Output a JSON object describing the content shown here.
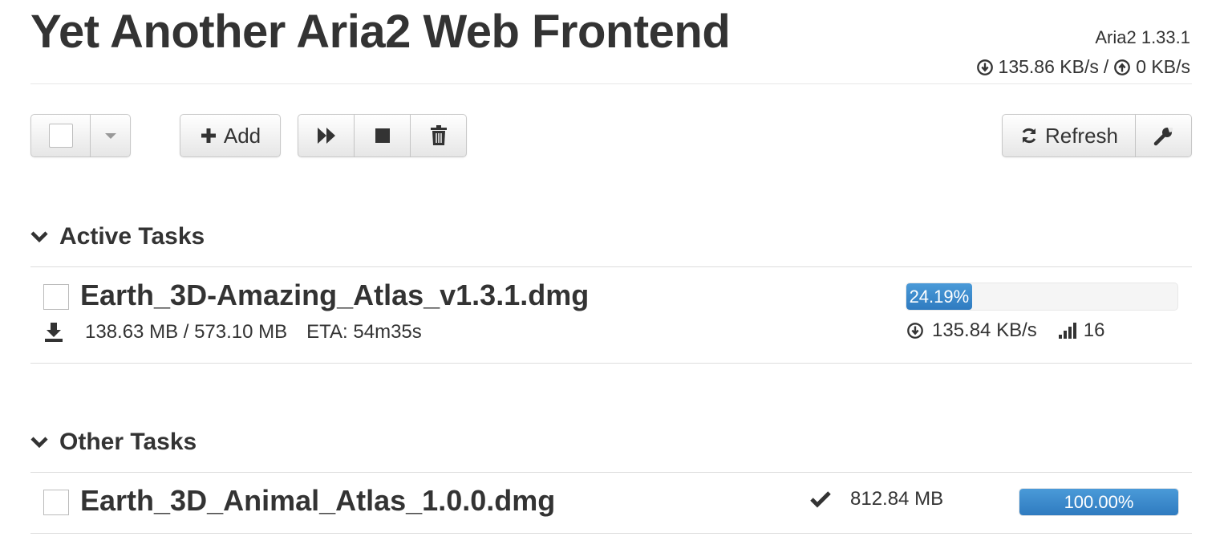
{
  "header": {
    "title": "Yet Another Aria2 Web Frontend",
    "version": "Aria2 1.33.1",
    "download_speed": "135.86 KB/s",
    "separator": "/",
    "upload_speed": "0 KB/s"
  },
  "toolbar": {
    "add_label": "Add",
    "refresh_label": "Refresh"
  },
  "active_section": {
    "title": "Active Tasks",
    "tasks": [
      {
        "name": "Earth_3D-Amazing_Atlas_v1.3.1.dmg",
        "size_progress": "138.63 MB / 573.10 MB",
        "eta": "ETA: 54m35s",
        "progress": 24.19,
        "progress_label": "24.19%",
        "speed": "135.84 KB/s",
        "connections": "16"
      }
    ]
  },
  "other_section": {
    "title": "Other Tasks",
    "tasks": [
      {
        "name": "Earth_3D_Animal_Atlas_1.0.0.dmg",
        "size": "812.84 MB",
        "progress": 100,
        "progress_label": "100.00%"
      }
    ]
  },
  "colors": {
    "progress": "#2f7bc0",
    "text": "#333333"
  }
}
